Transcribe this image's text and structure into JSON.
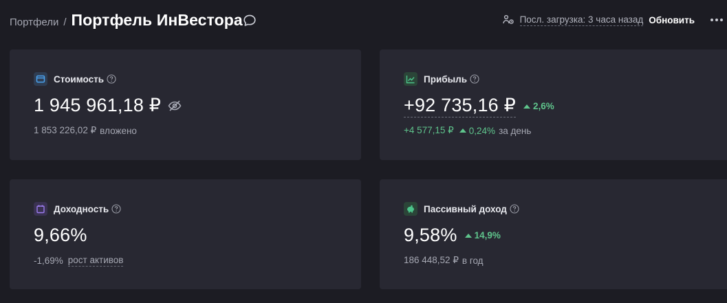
{
  "header": {
    "breadcrumb_link": "Портфели",
    "breadcrumb_sep": "/",
    "title": "Портфель ИнВестора",
    "status_text": "Посл. загрузка: 3 часа назад",
    "refresh_label": "Обновить"
  },
  "cards": {
    "value": {
      "title": "Стоимость",
      "amount": "1 945 961,18 ₽",
      "sub_amount": "1 853 226,02 ₽",
      "sub_label": "вложено"
    },
    "profit": {
      "title": "Прибыль",
      "amount": "+92 735,16 ₽",
      "change": "2,6%",
      "day_amount": "+4 577,15 ₽",
      "day_change": "0,24%",
      "day_label": "за день"
    },
    "yield": {
      "title": "Доходность",
      "amount": "9,66%",
      "sub_value": "-1,69%",
      "sub_link": "рост активов"
    },
    "passive": {
      "title": "Пассивный доход",
      "amount": "9,58%",
      "change": "14,9%",
      "sub_amount": "186 448,52 ₽",
      "sub_label": "в год"
    }
  },
  "colors": {
    "background": "#1c1c23",
    "card": "#282832",
    "positive": "#5fc48c",
    "value_icon": "#4aa3f0",
    "profit_icon": "#4cc38a",
    "yield_icon": "#9d7df0",
    "passive_icon": "#4cc38a"
  },
  "icons": {
    "comment": "speech-bubble-icon",
    "status": "data-source-icon",
    "more": "ellipsis-icon",
    "value": "wallet-icon",
    "profit": "chart-up-icon",
    "yield": "calendar-icon",
    "passive": "piggy-bank-icon",
    "help": "question-circle-icon",
    "hide": "eye-off-icon"
  }
}
